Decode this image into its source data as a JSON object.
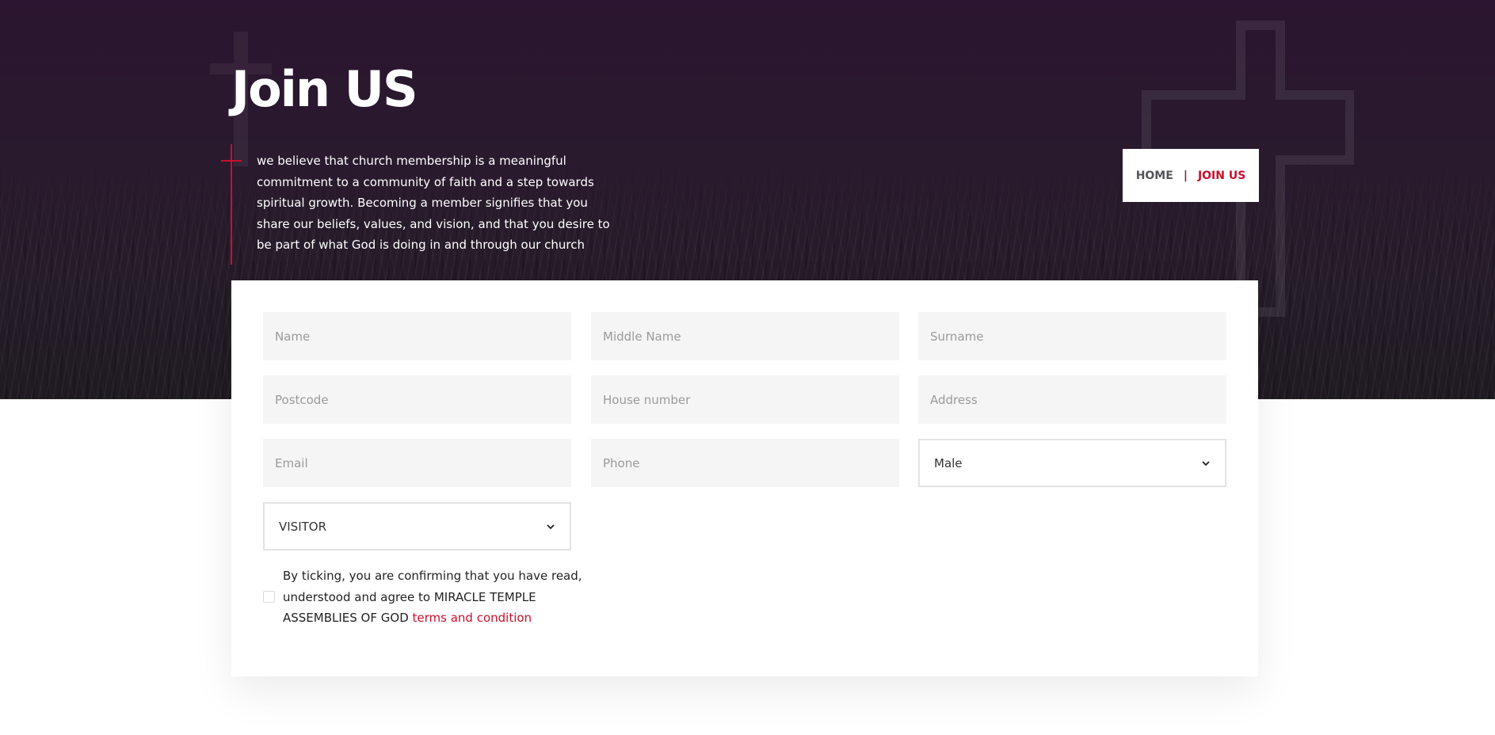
{
  "hero": {
    "title": "Join US",
    "intro": "we believe that church membership is a meaningful commitment to a community of faith and a step towards spiritual growth. Becoming a member signifies that you share our beliefs, values, and vision, and that you desire to be part of what God is doing in and through our church"
  },
  "breadcrumb": {
    "home": "HOME",
    "separator": "|",
    "current": "JOIN US"
  },
  "form": {
    "fields": {
      "name": "Name",
      "middle_name": "Middle Name",
      "surname": "Surname",
      "postcode": "Postcode",
      "house_number": "House number",
      "address": "Address",
      "email": "Email",
      "phone": "Phone"
    },
    "gender": {
      "selected": "Male"
    },
    "membership": {
      "selected": "VISITOR"
    },
    "consent": {
      "text": "By ticking, you are confirming that you have read, understood and agree to MIRACLE TEMPLE ASSEMBLIES OF GOD ",
      "link": "terms and condition"
    }
  },
  "colors": {
    "accent": "#c8102e",
    "hero_bg": "#2a1a2e",
    "field_bg": "#f5f5f5"
  }
}
